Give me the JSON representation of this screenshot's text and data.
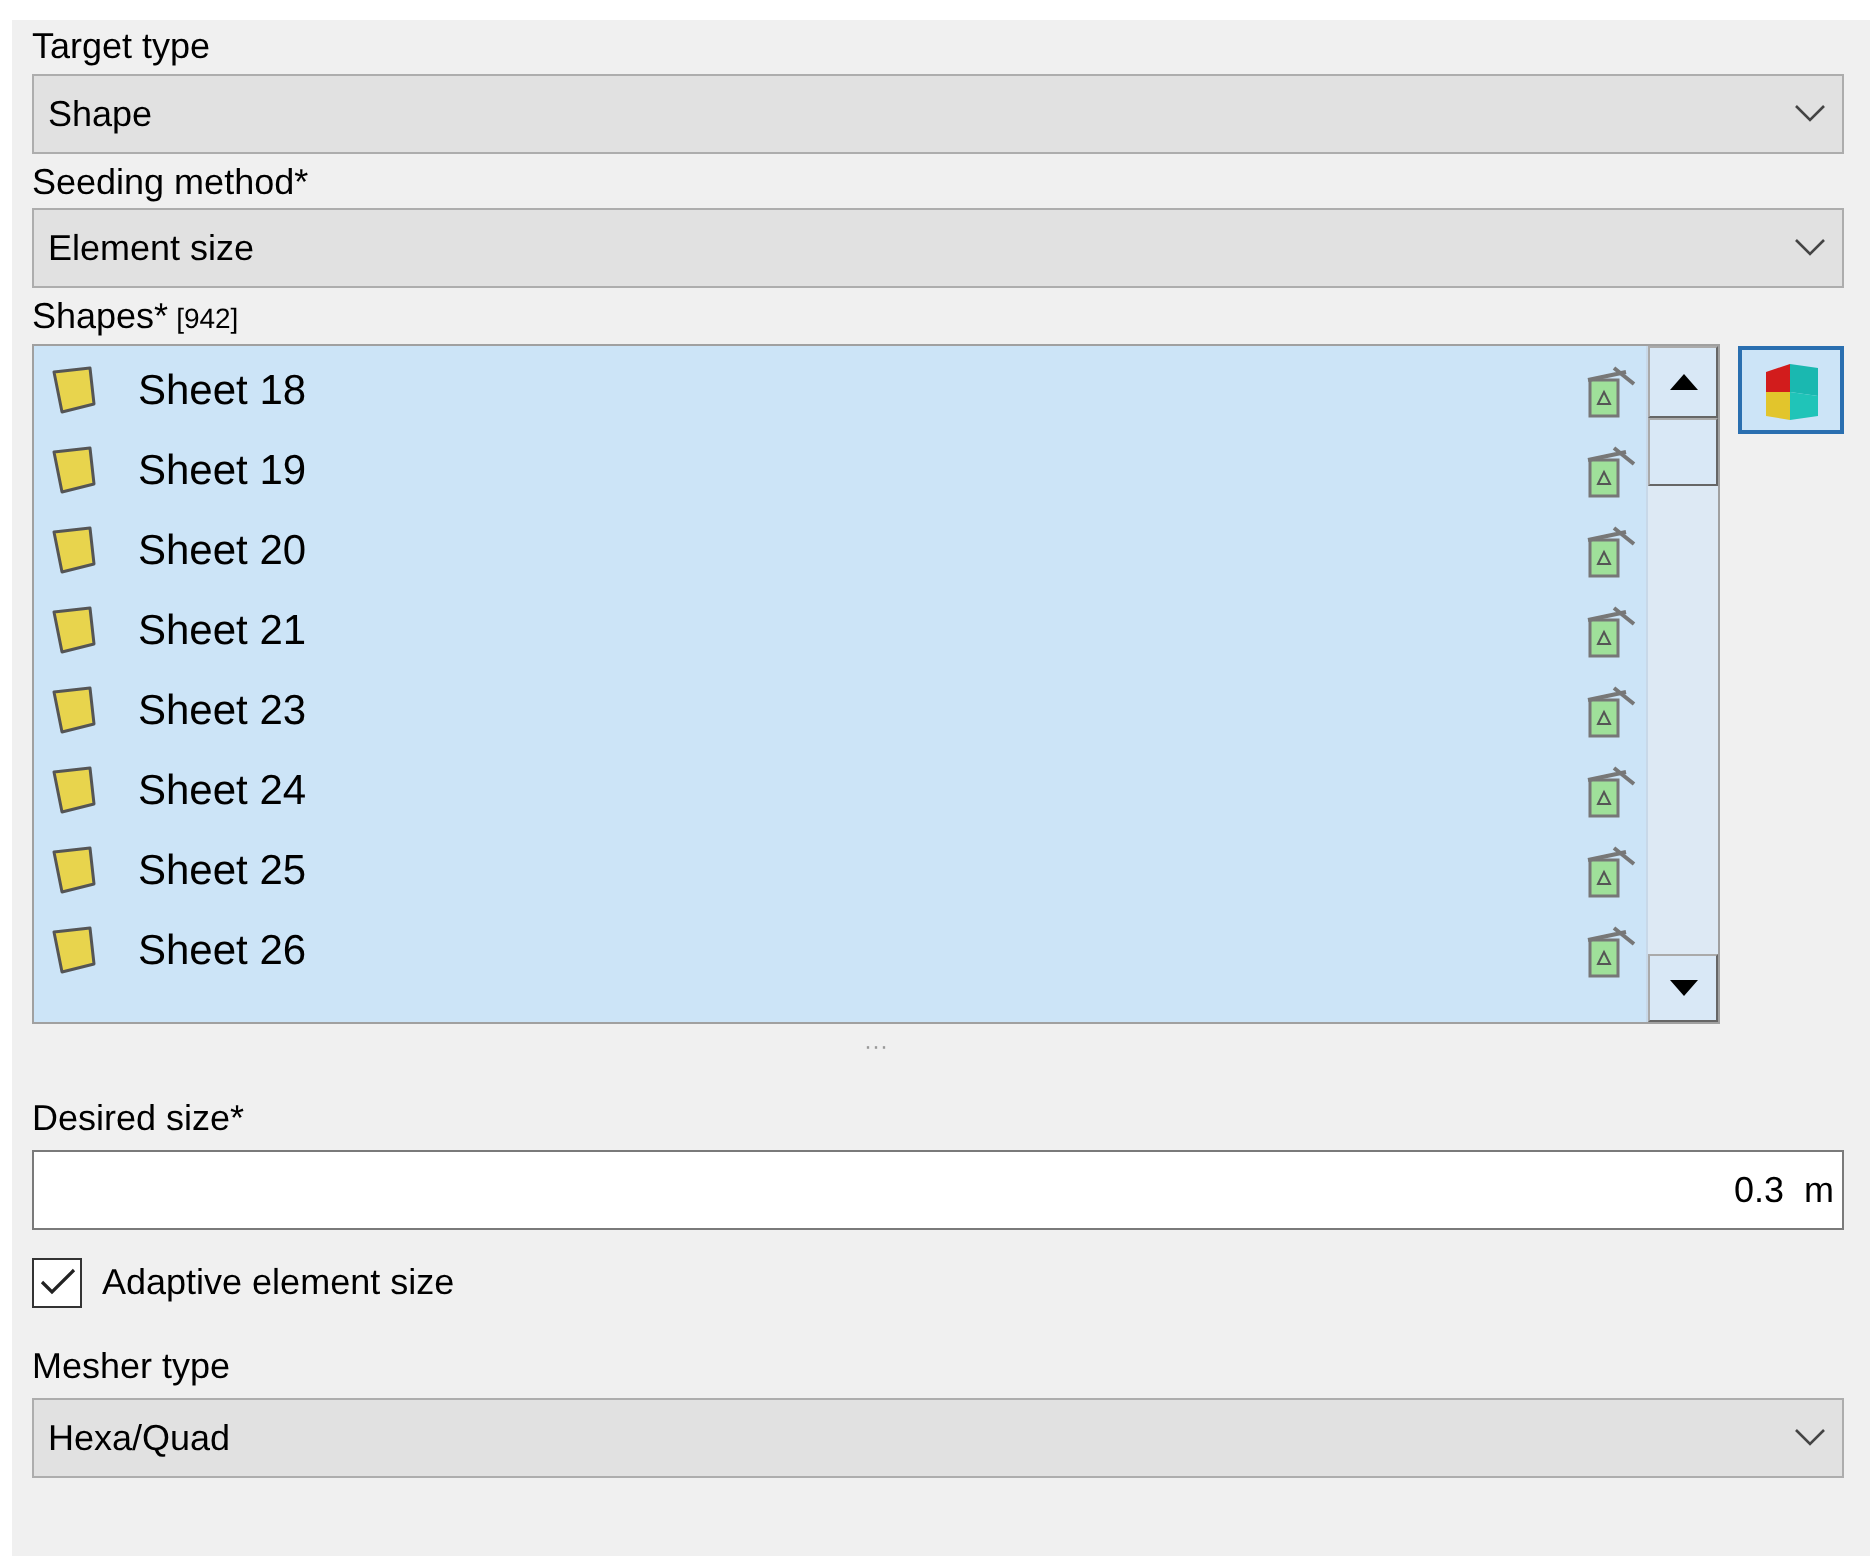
{
  "target_type": {
    "label": "Target type",
    "value": "Shape"
  },
  "seeding_method": {
    "label": "Seeding method*",
    "value": "Element size"
  },
  "shapes": {
    "label": "Shapes*",
    "count": "[942]",
    "items": [
      {
        "name": "Sheet 18",
        "selected": true
      },
      {
        "name": "Sheet 19",
        "selected": true
      },
      {
        "name": "Sheet 20",
        "selected": true
      },
      {
        "name": "Sheet 21",
        "selected": true
      },
      {
        "name": "Sheet 23",
        "selected": true
      },
      {
        "name": "Sheet 24",
        "selected": true
      },
      {
        "name": "Sheet 25",
        "selected": true
      },
      {
        "name": "Sheet 26",
        "selected": true
      }
    ]
  },
  "splitter": "···",
  "desired_size": {
    "label": "Desired size*",
    "value": "0.3",
    "unit": "m"
  },
  "adaptive": {
    "label": "Adaptive element size",
    "checked": true
  },
  "mesher_type": {
    "label": "Mesher type",
    "value": "Hexa/Quad"
  }
}
